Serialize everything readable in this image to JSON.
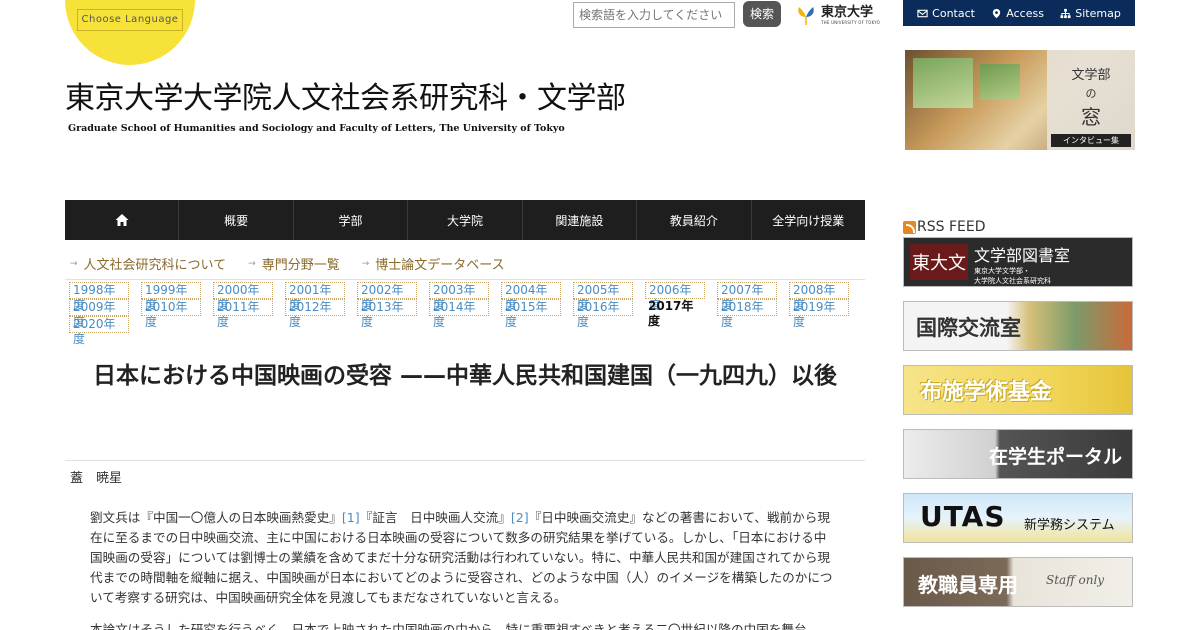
{
  "language": {
    "button_label": "Choose Language"
  },
  "search": {
    "placeholder": "検索語を入力してください",
    "button_label": "検索"
  },
  "university_logo": {
    "jp": "東京大学",
    "en": "THE UNIVERSITY OF TOKYO",
    "icon": "ginkgo-leaf-icon"
  },
  "topnav": [
    {
      "label": "Contact",
      "icon": "mail-icon"
    },
    {
      "label": "Access",
      "icon": "map-pin-icon"
    },
    {
      "label": "Sitemap",
      "icon": "sitemap-icon"
    }
  ],
  "site_title": {
    "jp": "東京大学大学院人文社会系研究科・文学部",
    "en": "Graduate School of Humanities and Sociology and Faculty of Letters, The University of Tokyo"
  },
  "mainnav": [
    {
      "label": "",
      "icon": "home-icon"
    },
    {
      "label": "概要"
    },
    {
      "label": "学部"
    },
    {
      "label": "大学院"
    },
    {
      "label": "関連施設"
    },
    {
      "label": "教員紹介"
    },
    {
      "label": "全学向け授業"
    }
  ],
  "subnav": [
    {
      "label": "人文社会研究科について"
    },
    {
      "label": "専門分野一覧"
    },
    {
      "label": "博士論文データベース"
    }
  ],
  "years": [
    "1998年度",
    "1999年度",
    "2000年度",
    "2001年度",
    "2002年度",
    "2003年度",
    "2004年度",
    "2005年度",
    "2006年度",
    "2007年度",
    "2008年度",
    "2009年度",
    "2010年度",
    "2011年度",
    "2012年度",
    "2013年度",
    "2014年度",
    "2015年度",
    "2016年度",
    "2017年度",
    "2018年度",
    "2019年度",
    "2020年度"
  ],
  "current_year": "2017年度",
  "article": {
    "title": "日本における中国映画の受容 ——中華人民共和国建国（一九四九）以後",
    "author": "蓋　暁星",
    "para1_a": "劉文兵は『中国一〇億人の日本映画熱愛史』",
    "ref1": "[1]",
    "para1_b": "『証言　日中映画人交流』",
    "ref2": "[2]",
    "para1_c": "『日中映画交流史』などの著書において、戦前から現在に至るまでの日中映画交流、主に中国における日本映画の受容について数多の研究結果を挙げている。しかし、「日本における中国映画の受容」については劉博士の業績を含めてまだ十分な研究活動は行われていない。特に、中華人民共和国が建国されてから現代までの時間軸を縦軸に据え、中国映画が日本においてどのように受容され、どのような中国（人）のイメージを構築したのかについて考察する研究は、中国映画研究全体を見渡してもまだなされていないと言える。",
    "para2": "本論文はそうした研究を行うべく、日本で上映された中国映画の中から、特に重要視すべきと考える二〇世紀以降の中国を舞台"
  },
  "sidebar": {
    "mado": {
      "line1": "文学部",
      "line2": "の",
      "line3": "窓",
      "line4": "インタビュー集"
    },
    "rss_label": "RSS FEED",
    "library": {
      "logo": "東大文",
      "title": "文学部図書室",
      "sub1": "東京大学文学部・",
      "sub2": "大学院人文社会系研究科"
    },
    "intl": "国際交流室",
    "fund": "布施学術基金",
    "portal": "在学生ポータル",
    "utas": {
      "title": "UTAS",
      "sub": "新学務システム"
    },
    "staff": {
      "title": "教職員専用",
      "sub": "Staff only"
    }
  }
}
